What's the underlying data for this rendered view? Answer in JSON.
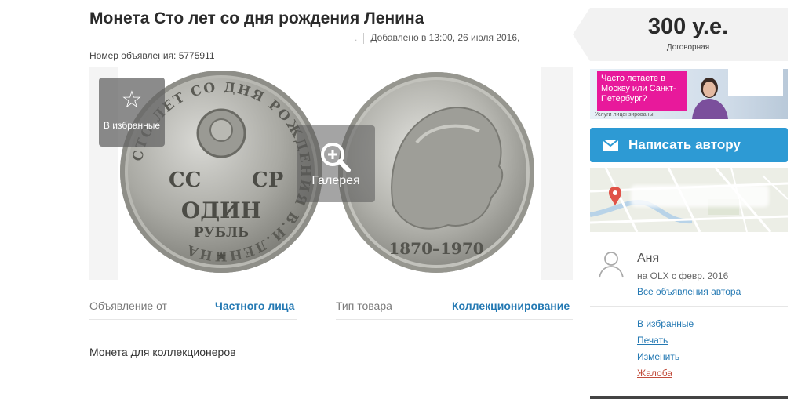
{
  "listing": {
    "title": "Монета Сто лет со дня рождения Ленина",
    "added_dot": ".",
    "added_text": "Добавлено в 13:00, 26 июля 2016,",
    "ad_number_label": "Номер объявления: 5775911",
    "description": "Монета для коллекционеров"
  },
  "gallery": {
    "favorite_label": "В избранные",
    "favorite_icon": "star-outline-icon",
    "gallery_label": "Галерея",
    "gallery_icon": "zoom-plus-icon",
    "coin_left_text": [
      "СТО ЛЕТ СО ДНЯ РОЖДЕНИЯ В.И.ЛЕНИНА",
      "СС",
      "СР",
      "ОДИН",
      "РУБЛЬ"
    ],
    "coin_right_text": "1870–1970"
  },
  "params": [
    {
      "label": "Объявление от",
      "value": "Частного лица"
    },
    {
      "label": "Тип товара",
      "value": "Коллекционирование"
    }
  ],
  "price": {
    "value": "300 у.е.",
    "note": "Договорная"
  },
  "banner": {
    "text": "Часто летаете в Москву или Санкт-Петербург?",
    "small": "Услуги лицензированы.",
    "bg_color": "#e8199b"
  },
  "contact": {
    "write_label": "Написать автору",
    "write_icon": "envelope-icon",
    "button_color": "#2d9ad4"
  },
  "user": {
    "name": "Аня",
    "since": "на OLX с февр. 2016",
    "all_ads": "Все объявления автора",
    "avatar_icon": "user-icon"
  },
  "actions": [
    {
      "label": "В избранные"
    },
    {
      "label": "Печать"
    },
    {
      "label": "Изменить"
    },
    {
      "label": "Жалоба"
    }
  ],
  "colors": {
    "link": "#2479b3",
    "complaint": "#c24d3c"
  }
}
